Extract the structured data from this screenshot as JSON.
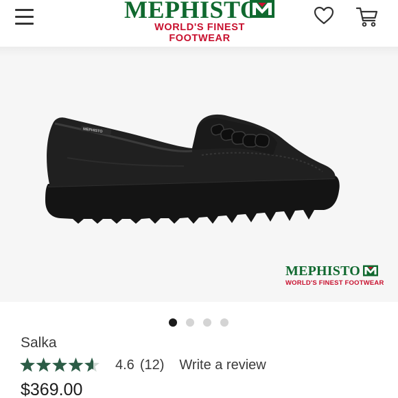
{
  "header": {
    "logo_word": "MEPHISTO",
    "logo_tagline": "WORLD'S FINEST FOOTWEAR",
    "menu_icon": "hamburger-menu-icon",
    "wishlist_icon": "heart-icon",
    "cart_icon": "cart-icon"
  },
  "gallery": {
    "image_logo_word": "MEPHISTO",
    "image_logo_tagline": "WORLD'S FINEST FOOTWEAR",
    "image_count": 4,
    "active_image": 1
  },
  "product": {
    "name": "Salka",
    "rating_value": "4.6",
    "rating_count": "(12)",
    "rating_stars": 4.6,
    "write_review_label": "Write a review",
    "price": "$369.00"
  },
  "colors": {
    "brand_green": "#10692f",
    "brand_red": "#c8102e",
    "star_green": "#2c5c46",
    "active_dot": "#1b1b1b",
    "inactive_dot": "#d4d4d4"
  }
}
